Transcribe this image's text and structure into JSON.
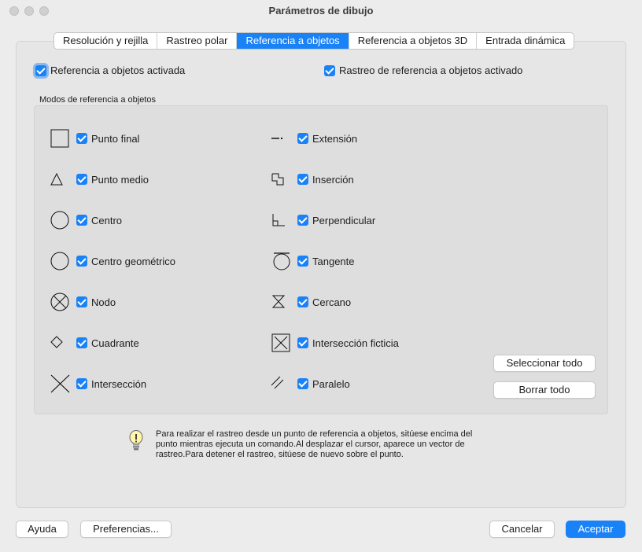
{
  "window": {
    "title": "Parámetros de dibujo"
  },
  "tabs": [
    {
      "label": "Resolución y rejilla",
      "active": false
    },
    {
      "label": "Rastreo polar",
      "active": false
    },
    {
      "label": "Referencia a objetos",
      "active": true
    },
    {
      "label": "Referencia a objetos 3D",
      "active": false
    },
    {
      "label": "Entrada dinámica",
      "active": false
    }
  ],
  "options": {
    "osnap_on": {
      "label": "Referencia a objetos activada",
      "checked": true
    },
    "tracking_on": {
      "label": "Rastreo de referencia a objetos activado",
      "checked": true
    }
  },
  "modes": {
    "group_label": "Modos de referencia a objetos",
    "left": [
      {
        "label": "Punto final",
        "icon": "square-icon",
        "checked": true
      },
      {
        "label": "Punto medio",
        "icon": "triangle-icon",
        "checked": true
      },
      {
        "label": "Centro",
        "icon": "circle-icon",
        "checked": true
      },
      {
        "label": "Centro geométrico",
        "icon": "circle-icon",
        "checked": true
      },
      {
        "label": "Nodo",
        "icon": "node-icon",
        "checked": true
      },
      {
        "label": "Cuadrante",
        "icon": "diamond-icon",
        "checked": true
      },
      {
        "label": "Intersección",
        "icon": "x-icon",
        "checked": true
      }
    ],
    "right": [
      {
        "label": "Extensión",
        "icon": "extension-icon",
        "checked": true
      },
      {
        "label": "Inserción",
        "icon": "insertion-icon",
        "checked": true
      },
      {
        "label": "Perpendicular",
        "icon": "perpendicular-icon",
        "checked": true
      },
      {
        "label": "Tangente",
        "icon": "tangent-icon",
        "checked": true
      },
      {
        "label": "Cercano",
        "icon": "hourglass-icon",
        "checked": true
      },
      {
        "label": "Intersección ficticia",
        "icon": "boxed-x-icon",
        "checked": true
      },
      {
        "label": "Paralelo",
        "icon": "parallel-icon",
        "checked": true
      }
    ],
    "select_all": "Seleccionar todo",
    "clear_all": "Borrar todo"
  },
  "hint": {
    "icon": "lightbulb-icon",
    "lines": [
      "Para realizar el rastreo desde un punto de referencia a objetos, sitúese encima del",
      "punto mientras ejecuta un comando.Al desplazar el cursor, aparece un vector de",
      "rastreo.Para detener el rastreo, sitúese de nuevo sobre el punto."
    ]
  },
  "footer": {
    "help": "Ayuda",
    "preferences": "Preferencias...",
    "cancel": "Cancelar",
    "accept": "Aceptar"
  },
  "colors": {
    "accent": "#1a82f7",
    "panel": "#e6e6e6",
    "group": "#dedede"
  }
}
